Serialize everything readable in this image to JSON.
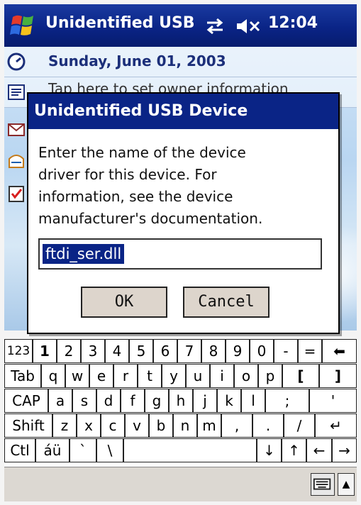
{
  "titlebar": {
    "title": "Unidentified USB D",
    "time": "12:04"
  },
  "today": {
    "date": "Sunday, June 01, 2003",
    "owner": "Tap here to set owner information"
  },
  "dialog": {
    "title": "Unidentified USB Device",
    "message_lines": [
      "Enter the name of the device",
      "driver for this device. For",
      "information, see the device",
      "manufacturer's documentation."
    ],
    "input_value": "ftdi_ser.dll",
    "ok_label": "OK",
    "cancel_label": "Cancel"
  },
  "keyboard": {
    "row1": [
      "123",
      "1",
      "2",
      "3",
      "4",
      "5",
      "6",
      "7",
      "8",
      "9",
      "0",
      "-",
      "=",
      "⬅"
    ],
    "row2": [
      "Tab",
      "q",
      "w",
      "e",
      "r",
      "t",
      "y",
      "u",
      "i",
      "o",
      "p",
      "[",
      "]"
    ],
    "row3": [
      "CAP",
      "a",
      "s",
      "d",
      "f",
      "g",
      "h",
      "j",
      "k",
      "l",
      ";",
      "'"
    ],
    "row4": [
      "Shift",
      "z",
      "x",
      "c",
      "v",
      "b",
      "n",
      "m",
      ",",
      ".",
      "/",
      "↵"
    ],
    "row5": [
      "Ctl",
      "áü",
      "`",
      "\\",
      "",
      "↓",
      "↑",
      "←",
      "→"
    ]
  },
  "menubar": {
    "sip_arrow": "▲"
  },
  "colors": {
    "titlebar": "#0a2486",
    "dialog_title": "#0a2486",
    "button_face": "#ddd5cc"
  }
}
